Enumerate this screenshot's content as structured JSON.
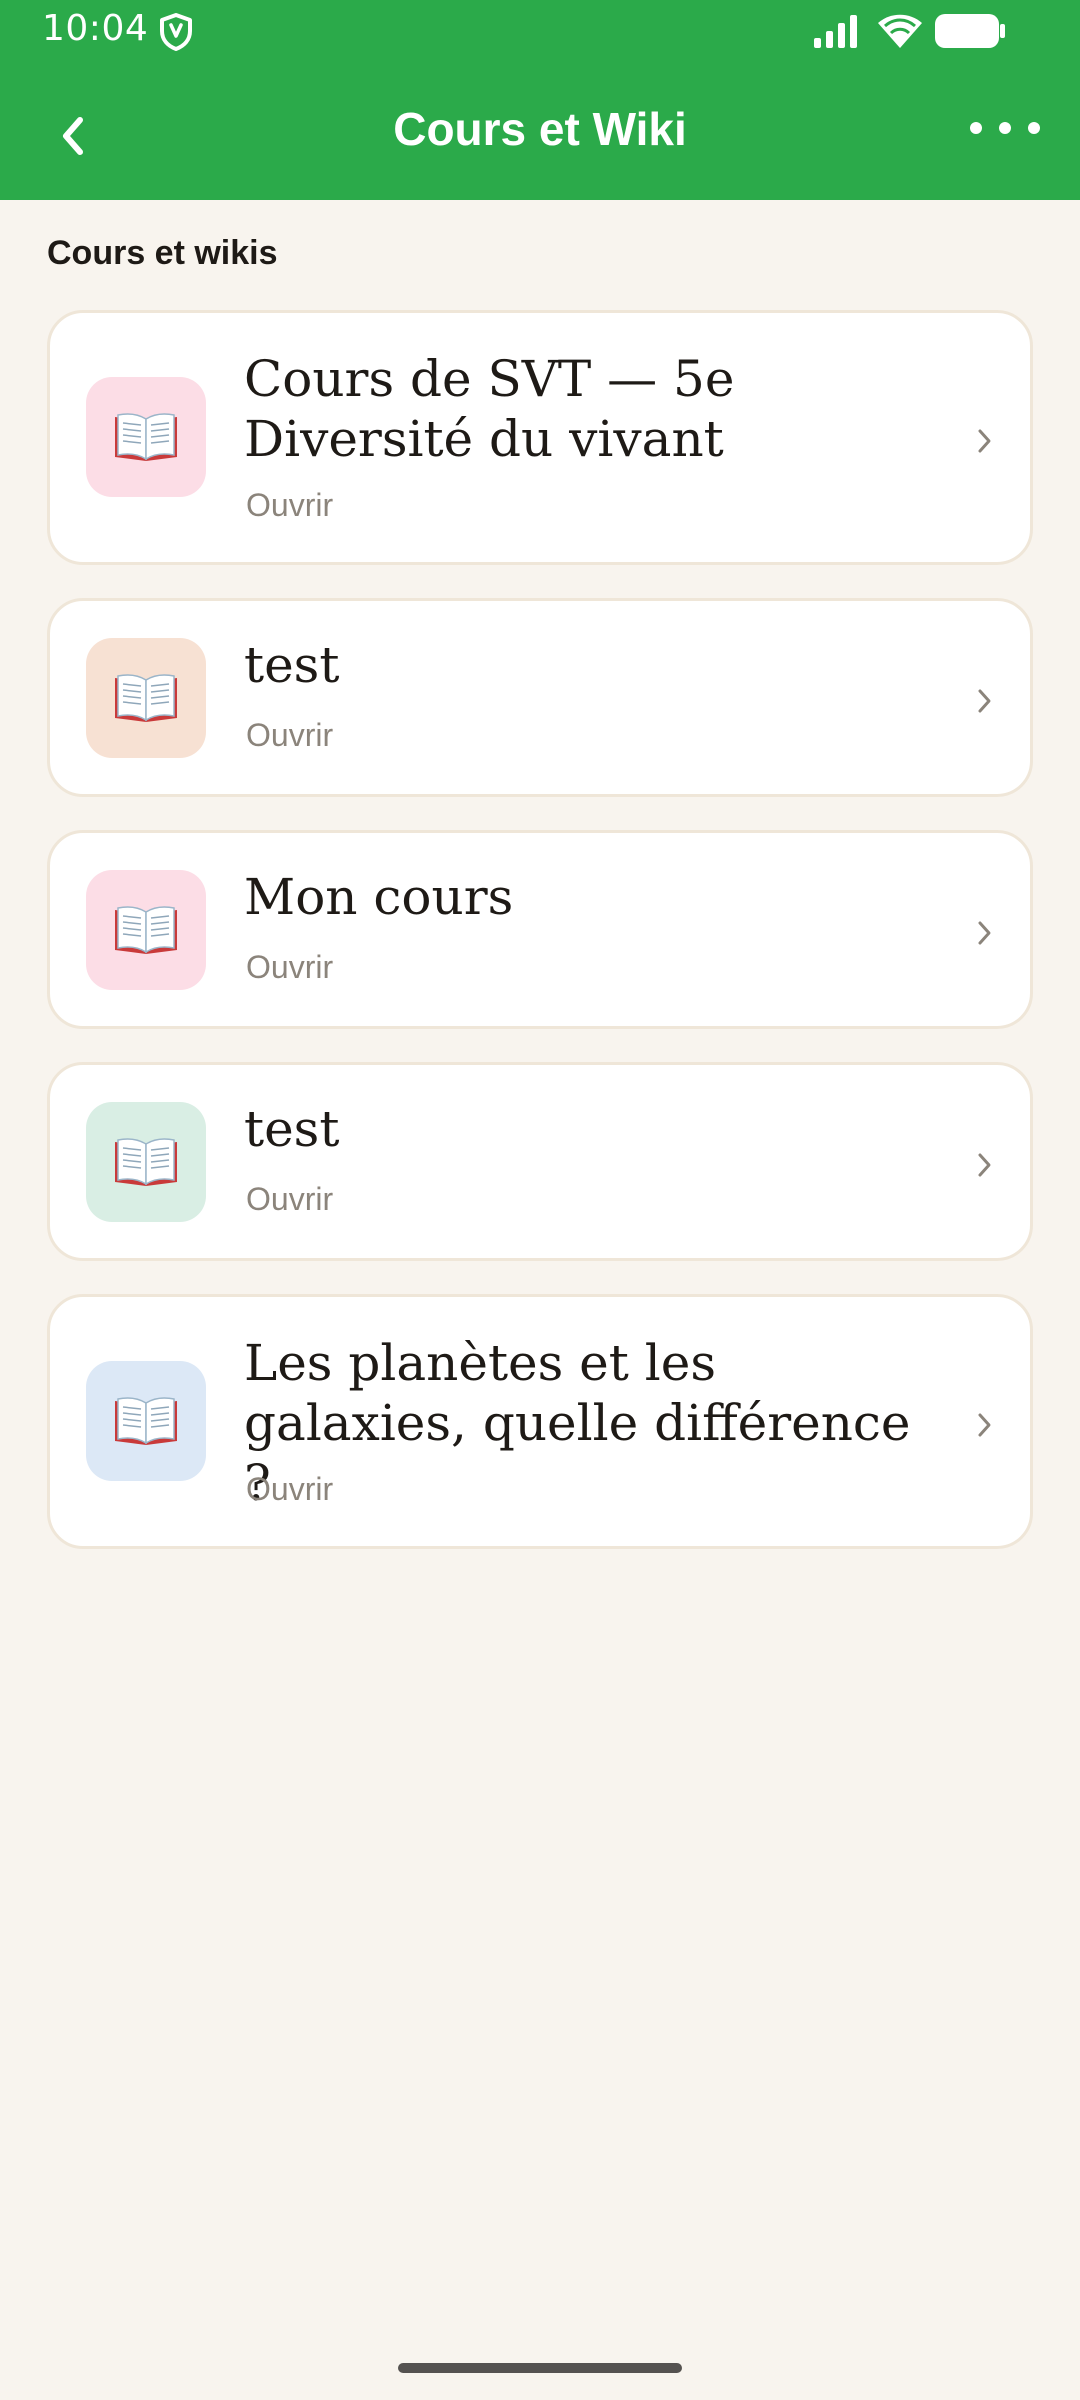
{
  "status": {
    "time": "10:04",
    "icons": [
      "shield-icon",
      "signal-icon",
      "wifi-icon",
      "battery-icon"
    ]
  },
  "header": {
    "title": "Cours et Wiki",
    "back_icon": "chevron-left-icon",
    "menu_icon": "more-horizontal-icon"
  },
  "section": {
    "label": "Cours et wikis"
  },
  "items": [
    {
      "title": "Cours de SVT — 5e Diversité du vivant",
      "subtitle": "Ouvrir",
      "tile_color": "#FCDDE6",
      "icon": "open-book-icon"
    },
    {
      "title": "test",
      "subtitle": "Ouvrir",
      "tile_color": "#F7E1D3",
      "icon": "open-book-icon"
    },
    {
      "title": "Mon cours",
      "subtitle": "Ouvrir",
      "tile_color": "#FCDDE6",
      "icon": "open-book-icon"
    },
    {
      "title": "test",
      "subtitle": "Ouvrir",
      "tile_color": "#D9EEE4",
      "icon": "open-book-icon"
    },
    {
      "title": "Les planètes et les galaxies, quelle différence ?",
      "subtitle": "Ouvrir",
      "tile_color": "#DCE8F6",
      "icon": "open-book-icon"
    }
  ],
  "colors": {
    "app_bar": "#2BAA4A",
    "background": "#F8F4EE",
    "card_border": "#EFE6D8"
  }
}
